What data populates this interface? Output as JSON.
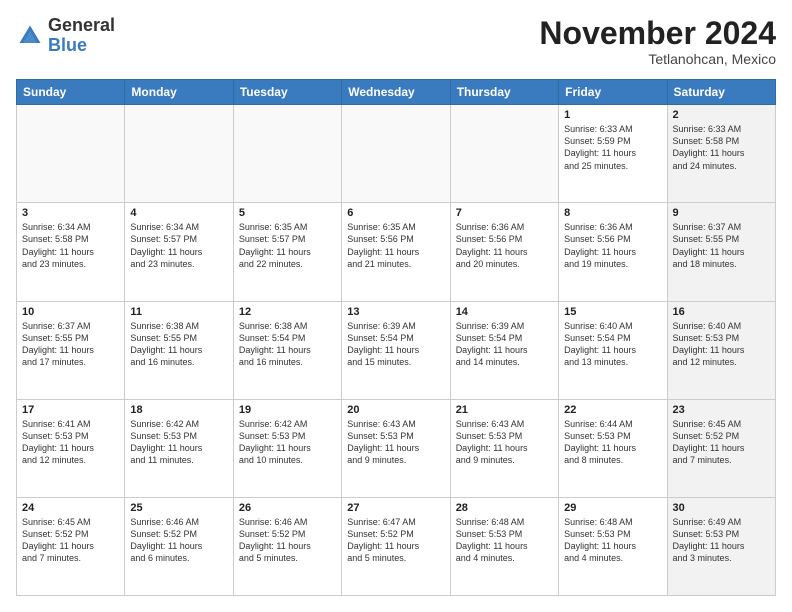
{
  "logo": {
    "general": "General",
    "blue": "Blue"
  },
  "header": {
    "month": "November 2024",
    "location": "Tetlanohcan, Mexico"
  },
  "weekdays": [
    "Sunday",
    "Monday",
    "Tuesday",
    "Wednesday",
    "Thursday",
    "Friday",
    "Saturday"
  ],
  "weeks": [
    [
      {
        "day": "",
        "info": "",
        "empty": true
      },
      {
        "day": "",
        "info": "",
        "empty": true
      },
      {
        "day": "",
        "info": "",
        "empty": true
      },
      {
        "day": "",
        "info": "",
        "empty": true
      },
      {
        "day": "",
        "info": "",
        "empty": true
      },
      {
        "day": "1",
        "info": "Sunrise: 6:33 AM\nSunset: 5:59 PM\nDaylight: 11 hours\nand 25 minutes.",
        "empty": false,
        "shaded": false
      },
      {
        "day": "2",
        "info": "Sunrise: 6:33 AM\nSunset: 5:58 PM\nDaylight: 11 hours\nand 24 minutes.",
        "empty": false,
        "shaded": true
      }
    ],
    [
      {
        "day": "3",
        "info": "Sunrise: 6:34 AM\nSunset: 5:58 PM\nDaylight: 11 hours\nand 23 minutes.",
        "empty": false,
        "shaded": false
      },
      {
        "day": "4",
        "info": "Sunrise: 6:34 AM\nSunset: 5:57 PM\nDaylight: 11 hours\nand 23 minutes.",
        "empty": false,
        "shaded": false
      },
      {
        "day": "5",
        "info": "Sunrise: 6:35 AM\nSunset: 5:57 PM\nDaylight: 11 hours\nand 22 minutes.",
        "empty": false,
        "shaded": false
      },
      {
        "day": "6",
        "info": "Sunrise: 6:35 AM\nSunset: 5:56 PM\nDaylight: 11 hours\nand 21 minutes.",
        "empty": false,
        "shaded": false
      },
      {
        "day": "7",
        "info": "Sunrise: 6:36 AM\nSunset: 5:56 PM\nDaylight: 11 hours\nand 20 minutes.",
        "empty": false,
        "shaded": false
      },
      {
        "day": "8",
        "info": "Sunrise: 6:36 AM\nSunset: 5:56 PM\nDaylight: 11 hours\nand 19 minutes.",
        "empty": false,
        "shaded": false
      },
      {
        "day": "9",
        "info": "Sunrise: 6:37 AM\nSunset: 5:55 PM\nDaylight: 11 hours\nand 18 minutes.",
        "empty": false,
        "shaded": true
      }
    ],
    [
      {
        "day": "10",
        "info": "Sunrise: 6:37 AM\nSunset: 5:55 PM\nDaylight: 11 hours\nand 17 minutes.",
        "empty": false,
        "shaded": false
      },
      {
        "day": "11",
        "info": "Sunrise: 6:38 AM\nSunset: 5:55 PM\nDaylight: 11 hours\nand 16 minutes.",
        "empty": false,
        "shaded": false
      },
      {
        "day": "12",
        "info": "Sunrise: 6:38 AM\nSunset: 5:54 PM\nDaylight: 11 hours\nand 16 minutes.",
        "empty": false,
        "shaded": false
      },
      {
        "day": "13",
        "info": "Sunrise: 6:39 AM\nSunset: 5:54 PM\nDaylight: 11 hours\nand 15 minutes.",
        "empty": false,
        "shaded": false
      },
      {
        "day": "14",
        "info": "Sunrise: 6:39 AM\nSunset: 5:54 PM\nDaylight: 11 hours\nand 14 minutes.",
        "empty": false,
        "shaded": false
      },
      {
        "day": "15",
        "info": "Sunrise: 6:40 AM\nSunset: 5:54 PM\nDaylight: 11 hours\nand 13 minutes.",
        "empty": false,
        "shaded": false
      },
      {
        "day": "16",
        "info": "Sunrise: 6:40 AM\nSunset: 5:53 PM\nDaylight: 11 hours\nand 12 minutes.",
        "empty": false,
        "shaded": true
      }
    ],
    [
      {
        "day": "17",
        "info": "Sunrise: 6:41 AM\nSunset: 5:53 PM\nDaylight: 11 hours\nand 12 minutes.",
        "empty": false,
        "shaded": false
      },
      {
        "day": "18",
        "info": "Sunrise: 6:42 AM\nSunset: 5:53 PM\nDaylight: 11 hours\nand 11 minutes.",
        "empty": false,
        "shaded": false
      },
      {
        "day": "19",
        "info": "Sunrise: 6:42 AM\nSunset: 5:53 PM\nDaylight: 11 hours\nand 10 minutes.",
        "empty": false,
        "shaded": false
      },
      {
        "day": "20",
        "info": "Sunrise: 6:43 AM\nSunset: 5:53 PM\nDaylight: 11 hours\nand 9 minutes.",
        "empty": false,
        "shaded": false
      },
      {
        "day": "21",
        "info": "Sunrise: 6:43 AM\nSunset: 5:53 PM\nDaylight: 11 hours\nand 9 minutes.",
        "empty": false,
        "shaded": false
      },
      {
        "day": "22",
        "info": "Sunrise: 6:44 AM\nSunset: 5:53 PM\nDaylight: 11 hours\nand 8 minutes.",
        "empty": false,
        "shaded": false
      },
      {
        "day": "23",
        "info": "Sunrise: 6:45 AM\nSunset: 5:52 PM\nDaylight: 11 hours\nand 7 minutes.",
        "empty": false,
        "shaded": true
      }
    ],
    [
      {
        "day": "24",
        "info": "Sunrise: 6:45 AM\nSunset: 5:52 PM\nDaylight: 11 hours\nand 7 minutes.",
        "empty": false,
        "shaded": false
      },
      {
        "day": "25",
        "info": "Sunrise: 6:46 AM\nSunset: 5:52 PM\nDaylight: 11 hours\nand 6 minutes.",
        "empty": false,
        "shaded": false
      },
      {
        "day": "26",
        "info": "Sunrise: 6:46 AM\nSunset: 5:52 PM\nDaylight: 11 hours\nand 5 minutes.",
        "empty": false,
        "shaded": false
      },
      {
        "day": "27",
        "info": "Sunrise: 6:47 AM\nSunset: 5:52 PM\nDaylight: 11 hours\nand 5 minutes.",
        "empty": false,
        "shaded": false
      },
      {
        "day": "28",
        "info": "Sunrise: 6:48 AM\nSunset: 5:53 PM\nDaylight: 11 hours\nand 4 minutes.",
        "empty": false,
        "shaded": false
      },
      {
        "day": "29",
        "info": "Sunrise: 6:48 AM\nSunset: 5:53 PM\nDaylight: 11 hours\nand 4 minutes.",
        "empty": false,
        "shaded": false
      },
      {
        "day": "30",
        "info": "Sunrise: 6:49 AM\nSunset: 5:53 PM\nDaylight: 11 hours\nand 3 minutes.",
        "empty": false,
        "shaded": true
      }
    ]
  ]
}
